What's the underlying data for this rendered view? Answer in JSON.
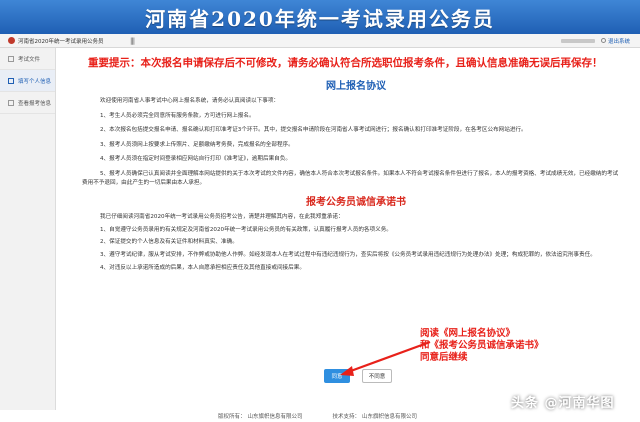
{
  "banner": {
    "title": "河南省2020年统一考试录用公务员"
  },
  "subheader": {
    "app_name": "河南省2020年统一考试录用公务员",
    "menu_toggle": "|||",
    "logout": "退出系统"
  },
  "sidebar": {
    "items": [
      {
        "label": "考试文件"
      },
      {
        "label": "填写个人信息"
      },
      {
        "label": "查看报考信息"
      }
    ]
  },
  "main": {
    "notice": "重要提示：本次报名申请保存后不可修改，请务必确认符合所选职位报考条件，且确认信息准确无误后再保存！",
    "agreement_title": "网上报名协议",
    "agreement_paras": [
      "欢迎使用河南省人事考试中心网上报名系统，请务必认真阅读以下事项：",
      "1、考生人员必须完全同意所有服务条款，方可进行网上报名。",
      "2、本次报名包括提交报名申请、报名确认和打印准考证3个环节。其中，提交报名申请阶段在河南省人事考试网进行；报名确认和打印准考证阶段，在各考区公布网站进行。",
      "3、报考人员须网上按要求上传照片、足额缴纳考务费，完成报名的全部程序。",
      "4、报考人员须在指定时间登录相应网站自行打印《准考证》，逾期后果自负。",
      "5、报考人员确保已认真阅读并全面理解本网站提供的关于本次考试的文件内容，确信本人符合本次考试报名条件。如果本人不符合考试报名条件但进行了报名，本人的报考资格、考试成绩无效，已经缴纳的考试费用不予退回，由此产生的一切后果由本人承担。"
    ],
    "promise_title": "报考公务员诚信承诺书",
    "promise_paras": [
      "我已仔细阅读河南省2020年统一考试录用公务员招考公告，清楚并理解其内容，在此我郑重承诺：",
      "1、自觉遵守公务员录用的有关规定及河南省2020年统一考试录用公务员的有关政策，认真履行报考人员的各项义务。",
      "2、保证提交的个人信息及有关证件和材料真实、准确。",
      "3、遵守考试纪律，服从考试安排，不作弊或协助他人作弊。如经发现本人在考试过程中有违纪违规行为，查实后将按《公务员考试录用违纪违规行为处理办法》处理；构成犯罪的，依法追究刑事责任。",
      "4、对违反以上承诺所造成的后果，本人自愿承担相应责任及其他直接或间接后果。"
    ],
    "agree_label": "同意",
    "disagree_label": "不同意"
  },
  "annotation": {
    "lines": [
      "阅读《网上报名协议》",
      "和《报考公务员诚信承诺书》",
      "同意后继续"
    ]
  },
  "footer": {
    "copyright_label": "版权所有：",
    "copyright_value": "山东旗帜信息有限公司",
    "support_label": "技术支持：",
    "support_value": "山东旗帜信息有限公司"
  },
  "watermark": {
    "text": "头条 @河南华图"
  },
  "colors": {
    "banner": "#1f5fb4",
    "notice_red": "#e8211a",
    "title_blue": "#1f5fb4",
    "agree_button": "#2f8fe0"
  }
}
